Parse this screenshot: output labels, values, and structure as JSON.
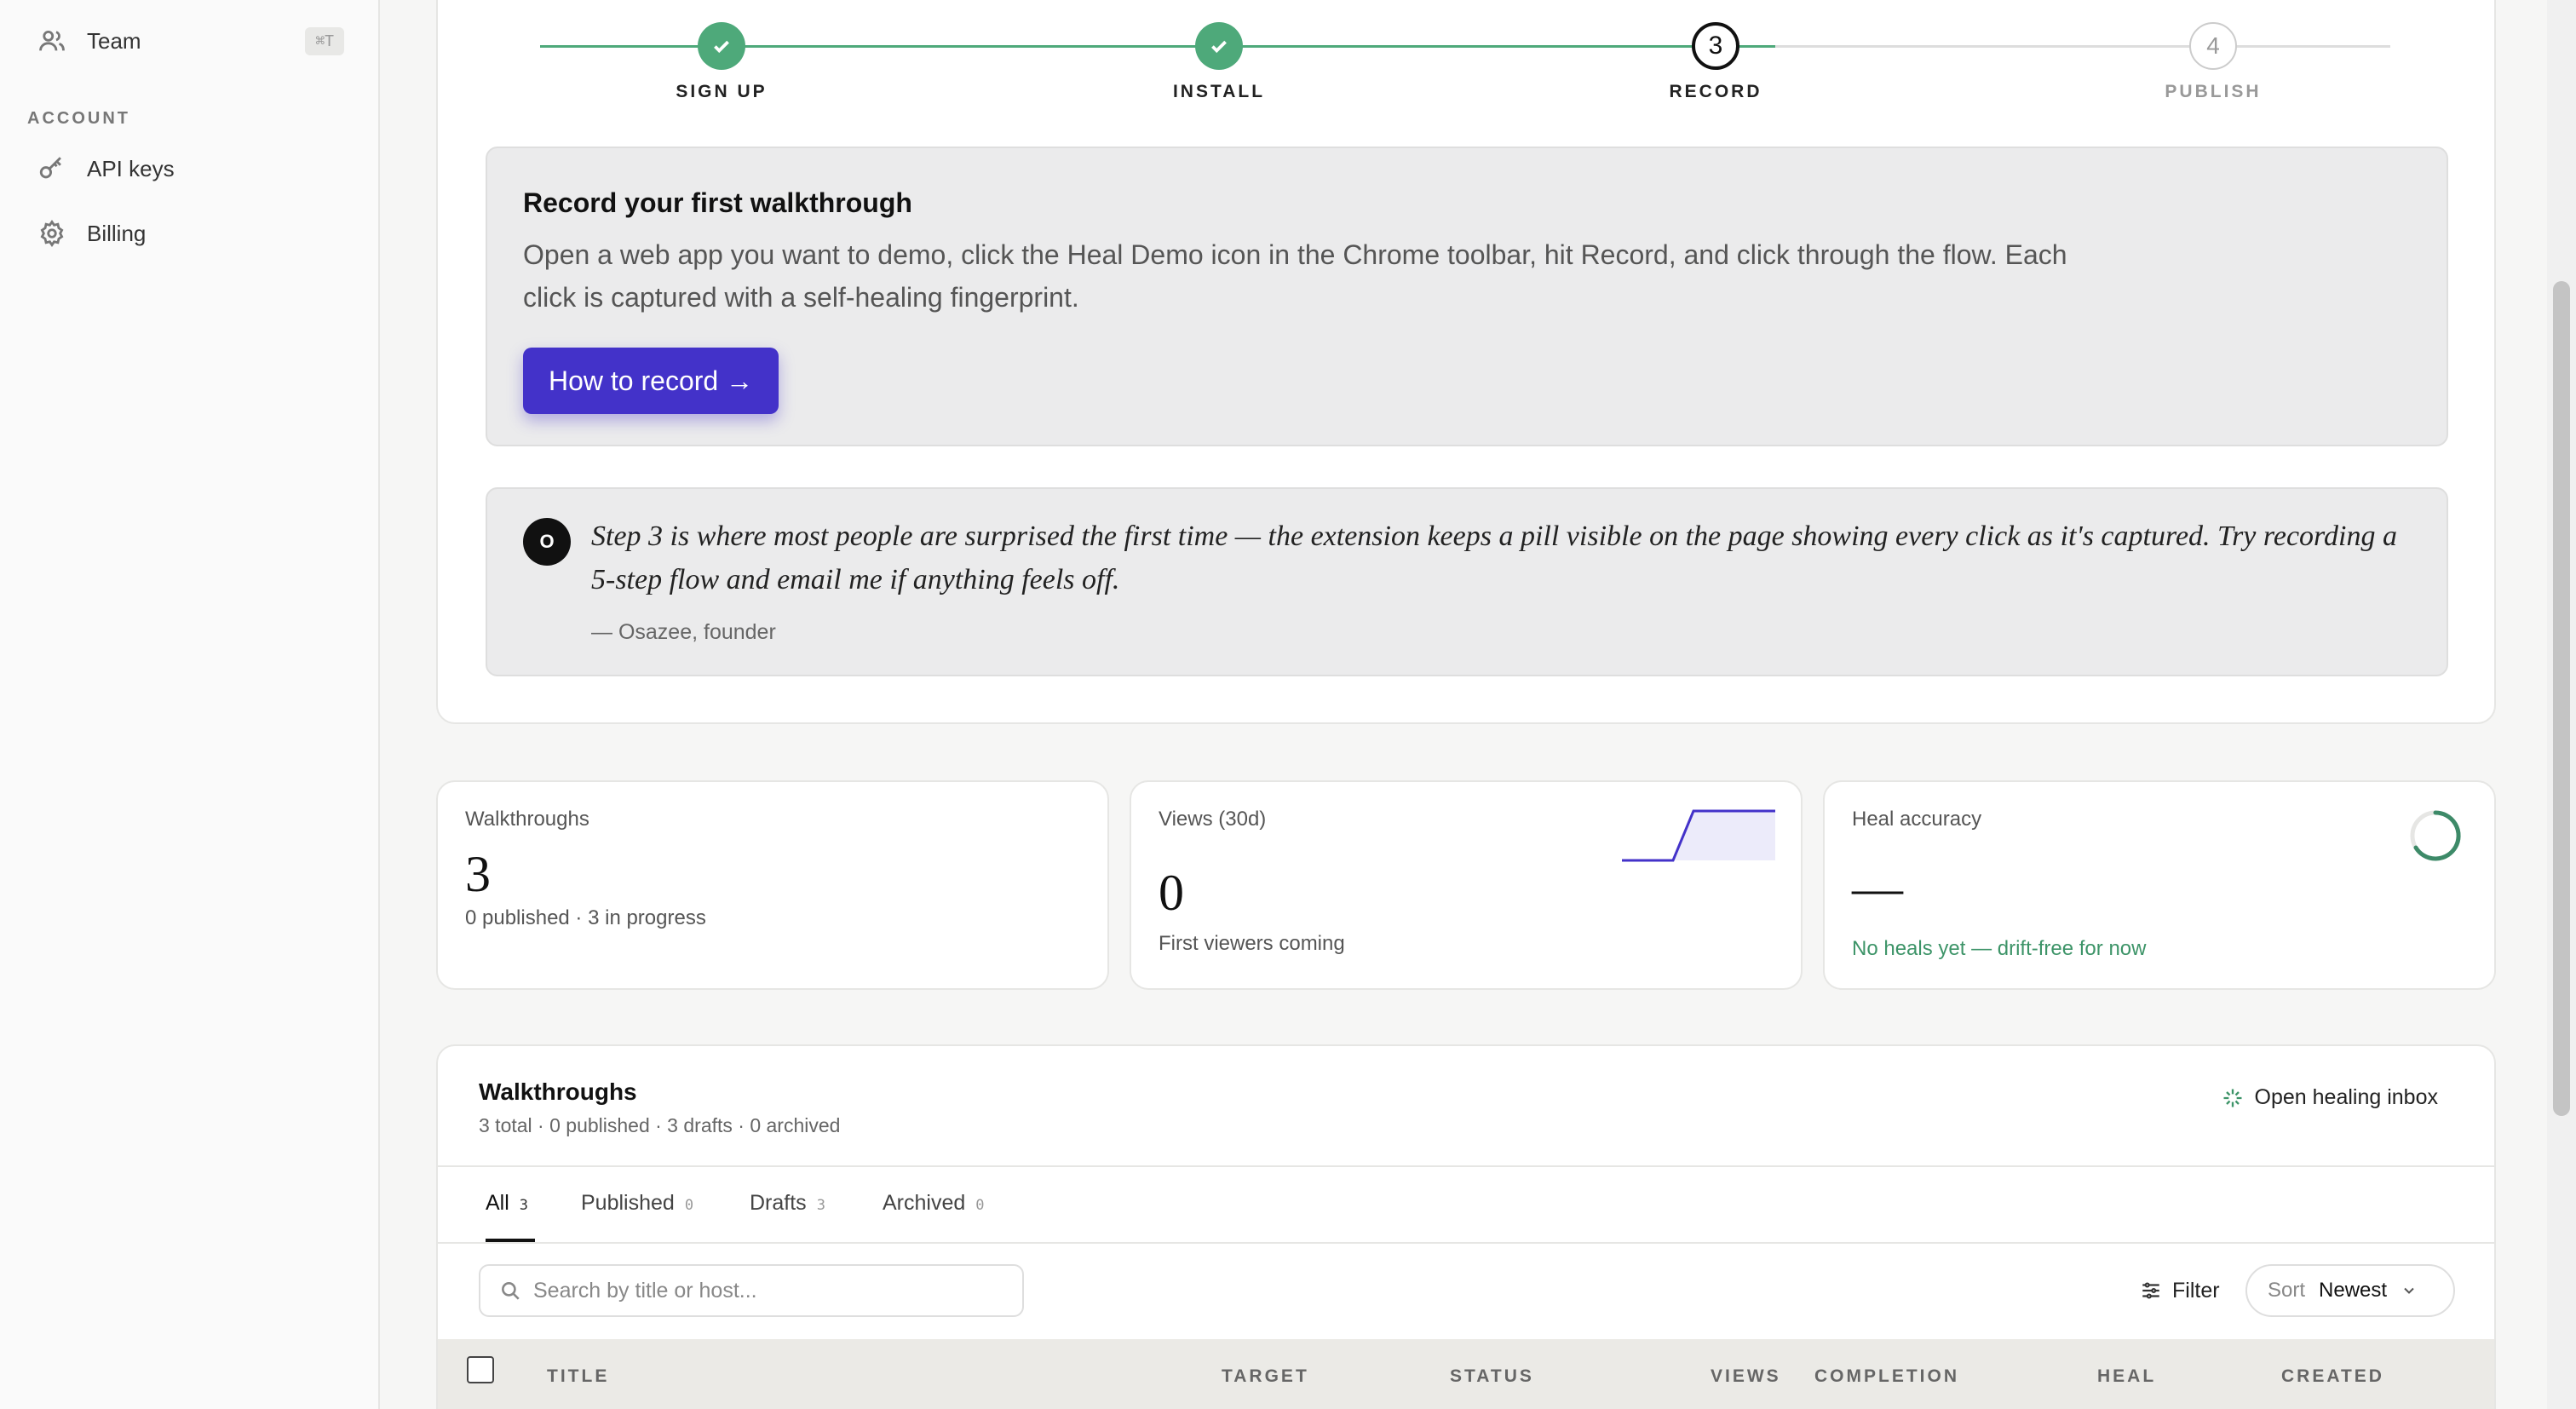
{
  "sidebar": {
    "items": [
      {
        "label": "Team",
        "shortcut": "⌘T",
        "icon": "users-icon"
      },
      {
        "label": "API keys",
        "icon": "key-icon"
      },
      {
        "label": "Billing",
        "icon": "gear-icon"
      }
    ],
    "section_account": "ACCOUNT"
  },
  "stepper": {
    "steps": [
      {
        "number": "1",
        "label": "SIGN UP",
        "state": "done"
      },
      {
        "number": "2",
        "label": "INSTALL",
        "state": "done"
      },
      {
        "number": "3",
        "label": "RECORD",
        "state": "current"
      },
      {
        "number": "4",
        "label": "PUBLISH",
        "state": "future"
      }
    ],
    "colors": {
      "done": "#4ea97a",
      "future_line": "#dddddd"
    }
  },
  "record_card": {
    "title": "Record your first walkthrough",
    "description": "Open a web app you want to demo, click the Heal Demo icon in the Chrome toolbar, hit Record, and click through the flow. Each click is captured with a self-healing fingerprint.",
    "button_label": "How to record →",
    "button_color": "#4332c9"
  },
  "quote": {
    "avatar_initial": "O",
    "text": "Step 3 is where most people are surprised the first time — the extension keeps a pill visible on the page showing every click as it's captured. Try recording a 5-step flow and email me if anything feels off.",
    "attribution": "— Osazee, founder"
  },
  "stats": {
    "walkthroughs": {
      "label": "Walkthroughs",
      "value": "3",
      "sub": "0 published · 3 in progress"
    },
    "views": {
      "label": "Views (30d)",
      "value": "0",
      "sub": "First viewers coming"
    },
    "heal": {
      "label": "Heal accuracy",
      "value": "—",
      "sub": "No heals yet — drift-free for now",
      "sub_color": "#3d9468"
    }
  },
  "list": {
    "title": "Walkthroughs",
    "meta": "3 total · 0 published · 3 drafts · 0 archived",
    "heal_inbox_label": "Open healing inbox",
    "tabs": [
      {
        "label": "All",
        "count": "3"
      },
      {
        "label": "Published",
        "count": "0"
      },
      {
        "label": "Drafts",
        "count": "3"
      },
      {
        "label": "Archived",
        "count": "0"
      }
    ],
    "active_tab": "All",
    "search_placeholder": "Search by title or host...",
    "filter_label": "Filter",
    "sort_label": "Sort",
    "sort_value": "Newest",
    "columns": [
      "TITLE",
      "TARGET",
      "STATUS",
      "VIEWS",
      "COMPLETION",
      "HEAL",
      "CREATED"
    ]
  }
}
